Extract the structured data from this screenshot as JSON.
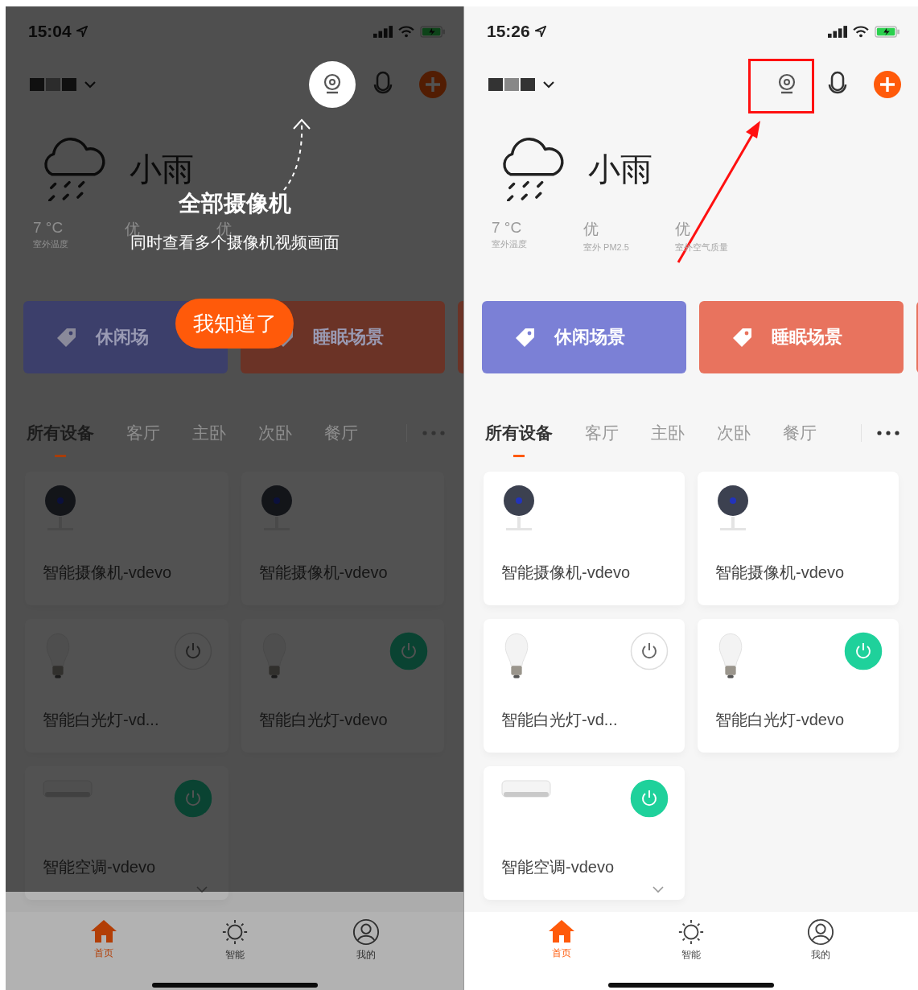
{
  "phones": [
    {
      "status_time": "15:04",
      "guide": {
        "title": "全部摄像机",
        "description": "同时查看多个摄像机视频画面",
        "button": "我知道了"
      },
      "weather": {
        "condition": "小雨",
        "stats": [
          {
            "value": "7 °C",
            "label": "室外温度"
          },
          {
            "value": "优"
          },
          {
            "value": "优"
          }
        ]
      },
      "scenes": [
        {
          "name": "休闲场",
          "color": "#3c3f6b"
        },
        {
          "name": "睡眠场景",
          "color": "#6b3326"
        },
        {
          "color": "#6b3326"
        }
      ],
      "tabs": [
        {
          "label": "所有设备",
          "selected": true
        },
        {
          "label": "客厅",
          "selected": false
        },
        {
          "label": "主卧",
          "selected": false
        },
        {
          "label": "次卧",
          "selected": false
        },
        {
          "label": "餐厅",
          "selected": false
        }
      ],
      "devices": [
        {
          "kind": "camera",
          "name": "智能摄像机-vdevo"
        },
        {
          "kind": "camera",
          "name": "智能摄像机-vdevo"
        },
        {
          "kind": "bulb",
          "name": "智能白光灯-vd...",
          "power": false
        },
        {
          "kind": "bulb",
          "name": "智能白光灯-vdevo",
          "power": true
        },
        {
          "kind": "ac",
          "name": "智能空调-vdevo",
          "power": true,
          "expandable": true
        }
      ],
      "nav": [
        {
          "kind": "home",
          "label": "首页",
          "selected": true
        },
        {
          "kind": "smart",
          "label": "智能",
          "selected": false
        },
        {
          "kind": "me",
          "label": "我的",
          "selected": false
        }
      ]
    },
    {
      "status_time": "15:26",
      "highlight": true,
      "weather": {
        "condition": "小雨",
        "stats": [
          {
            "value": "7 °C",
            "label": "室外温度"
          },
          {
            "value": "优",
            "label": "室外 PM2.5"
          },
          {
            "value": "优",
            "label": "室外空气质量"
          }
        ]
      },
      "scenes": [
        {
          "name": "休闲场景",
          "color": "#7b80d6"
        },
        {
          "name": "睡眠场景",
          "color": "#e8735e"
        },
        {
          "color": "#e8735e"
        }
      ],
      "tabs": [
        {
          "label": "所有设备",
          "selected": true
        },
        {
          "label": "客厅",
          "selected": false
        },
        {
          "label": "主卧",
          "selected": false
        },
        {
          "label": "次卧",
          "selected": false
        },
        {
          "label": "餐厅",
          "selected": false
        }
      ],
      "devices": [
        {
          "kind": "camera",
          "name": "智能摄像机-vdevo"
        },
        {
          "kind": "camera",
          "name": "智能摄像机-vdevo"
        },
        {
          "kind": "bulb",
          "name": "智能白光灯-vd...",
          "power": false
        },
        {
          "kind": "bulb",
          "name": "智能白光灯-vdevo",
          "power": true
        },
        {
          "kind": "ac",
          "name": "智能空调-vdevo",
          "power": true,
          "expandable": true
        }
      ],
      "nav": [
        {
          "kind": "home",
          "label": "首页",
          "selected": true
        },
        {
          "kind": "smart",
          "label": "智能",
          "selected": false
        },
        {
          "kind": "me",
          "label": "我的",
          "selected": false
        }
      ]
    }
  ]
}
